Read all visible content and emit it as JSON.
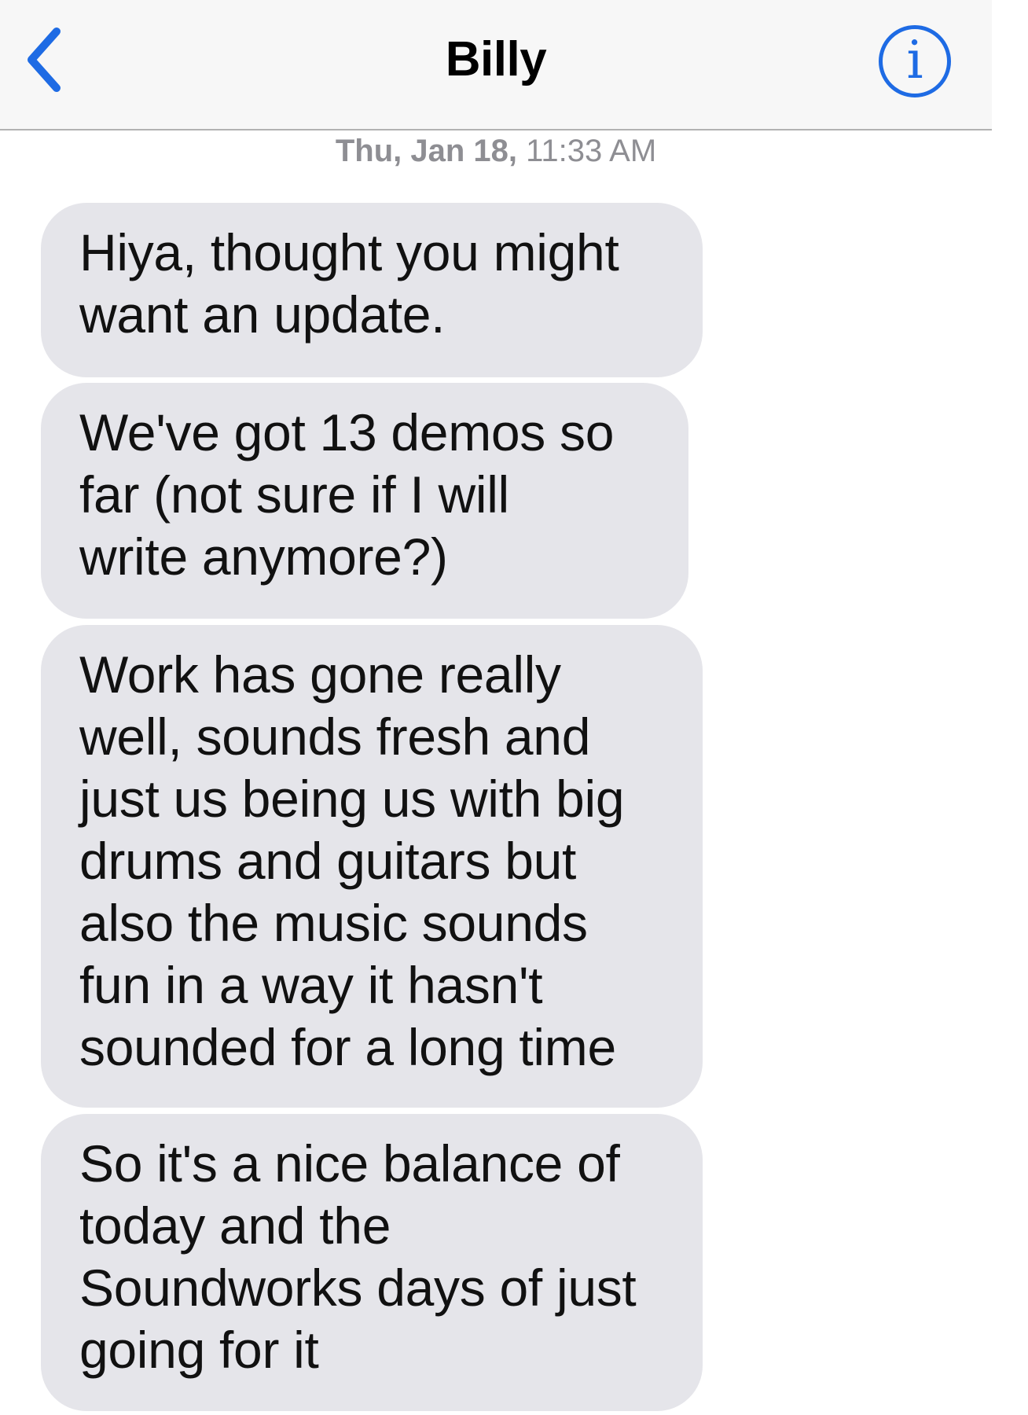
{
  "header": {
    "contact_name": "Billy",
    "back_icon": "chevron-left-icon",
    "info_icon": "info-icon",
    "info_glyph": "i",
    "accent_color": "#1e6be4"
  },
  "timestamp": {
    "day": "Thu, Jan 18,",
    "time": "11:33 AM"
  },
  "messages": [
    {
      "lines": [
        "Hiya, thought you might",
        "want an update."
      ]
    },
    {
      "lines": [
        "We've got 13 demos so",
        "far (not sure if I will",
        "write anymore?)"
      ]
    },
    {
      "lines": [
        "Work has gone really",
        "well, sounds fresh and",
        "just us being us with big",
        "drums and guitars but",
        "also the music sounds",
        "fun in a way it hasn't",
        "sounded for a long time"
      ]
    },
    {
      "lines": [
        "So it's a nice balance of",
        "today and the",
        "Soundworks days of just",
        "going for it"
      ]
    }
  ],
  "colors": {
    "bubble_background": "#e5e5ea",
    "navbar_background": "#f7f7f7",
    "timestamp_text": "#8e8e93"
  }
}
